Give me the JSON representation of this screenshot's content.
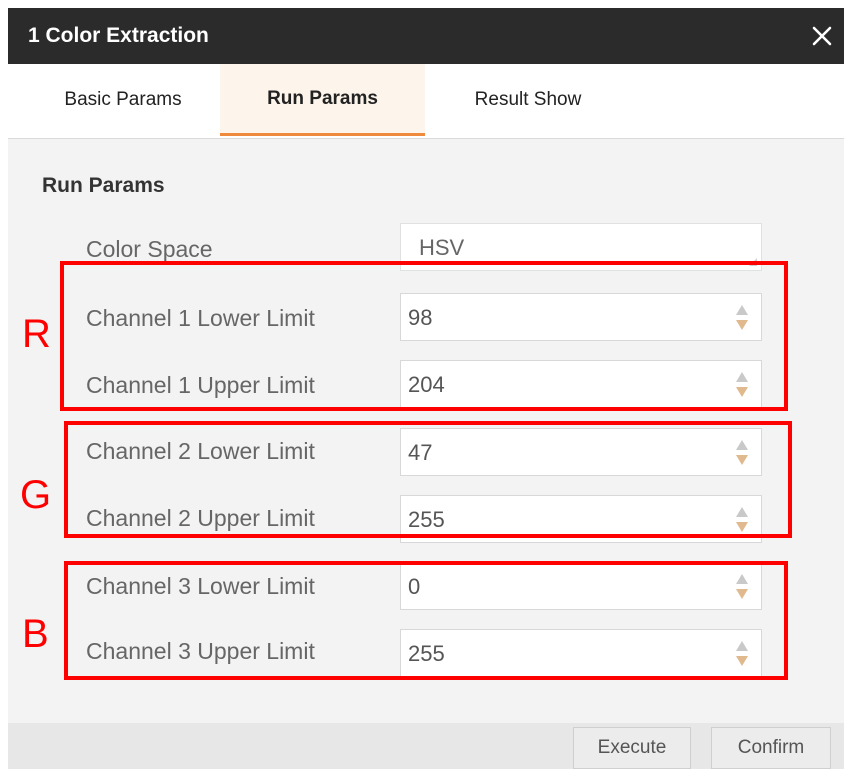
{
  "window": {
    "title": "1 Color Extraction",
    "close_icon": "close-icon"
  },
  "tabs": [
    {
      "label": "Basic Params",
      "active": false
    },
    {
      "label": "Run Params",
      "active": true
    },
    {
      "label": "Result Show",
      "active": false
    }
  ],
  "section": {
    "title": "Run Params"
  },
  "params": {
    "color_space": {
      "label": "Color Space",
      "value": "HSV"
    },
    "ch1_lower": {
      "label": "Channel 1 Lower Limit",
      "value": "98"
    },
    "ch1_upper": {
      "label": "Channel 1 Upper Limit",
      "value": "204"
    },
    "ch2_lower": {
      "label": "Channel 2 Lower Limit",
      "value": "47"
    },
    "ch2_upper": {
      "label": "Channel 2 Upper Limit",
      "value": "255"
    },
    "ch3_lower": {
      "label": "Channel 3 Lower Limit",
      "value": "0"
    },
    "ch3_upper": {
      "label": "Channel 3 Upper Limit",
      "value": "255"
    }
  },
  "annotations": {
    "r": "R",
    "g": "G",
    "b": "B",
    "color": "#ff0000"
  },
  "footer": {
    "execute_label": "Execute",
    "confirm_label": "Confirm"
  },
  "colors": {
    "title_bar": "#2b2b2b",
    "tab_accent": "#ef8a3c",
    "active_tab_bg": "#fdf4ec",
    "content_bg": "#f3f3f3"
  }
}
